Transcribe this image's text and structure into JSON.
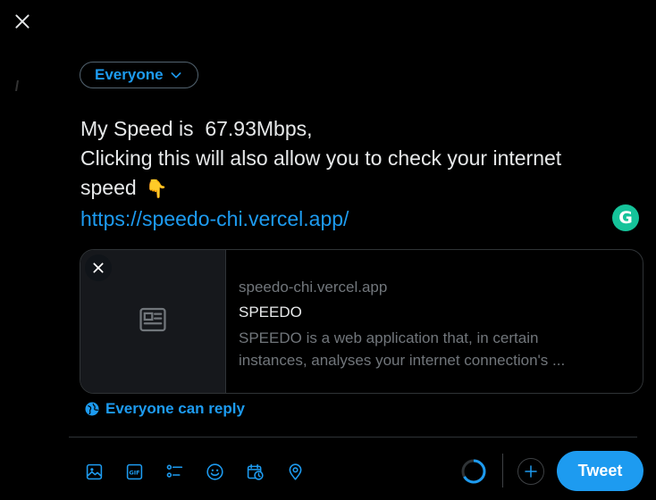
{
  "audience": {
    "label": "Everyone"
  },
  "composer": {
    "line1": "My Speed is  67.93Mbps,",
    "line2": "Clicking this will also allow you to check your internet",
    "line3": "speed",
    "emoji": "👇",
    "link": "https://speedo-chi.vercel.app/"
  },
  "grammarly": {
    "letter": "G"
  },
  "link_card": {
    "domain": "speedo-chi.vercel.app",
    "title": "SPEEDO",
    "description_line1": "SPEEDO is a web application that, in certain",
    "description_line2": "instances, analyses your internet connection's ..."
  },
  "reply_setting": {
    "label": "Everyone can reply"
  },
  "toolbar": {
    "icons": [
      "image-icon",
      "gif-icon",
      "poll-icon",
      "emoji-icon",
      "schedule-icon",
      "location-icon"
    ],
    "tweet_label": "Tweet"
  },
  "colors": {
    "accent": "#1d9bf0",
    "background": "#000000",
    "text": "#e7e9ea",
    "muted": "#71767b",
    "border": "#2f3336",
    "grammarly": "#15c39a"
  }
}
